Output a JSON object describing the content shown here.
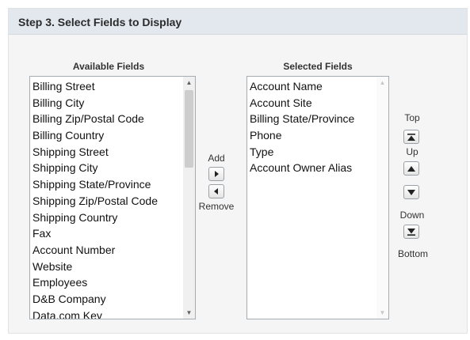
{
  "step_title": "Step 3. Select Fields to Display",
  "available": {
    "label": "Available Fields",
    "items": [
      "Billing Street",
      "Billing City",
      "Billing Zip/Postal Code",
      "Billing Country",
      "Shipping Street",
      "Shipping City",
      "Shipping State/Province",
      "Shipping Zip/Postal Code",
      "Shipping Country",
      "Fax",
      "Account Number",
      "Website",
      "Employees",
      "D&B Company",
      "Data.com Key"
    ]
  },
  "selected": {
    "label": "Selected Fields",
    "items": [
      "Account Name",
      "Account Site",
      "Billing State/Province",
      "Phone",
      "Type",
      "Account Owner Alias"
    ]
  },
  "move_controls": {
    "add_label": "Add",
    "remove_label": "Remove"
  },
  "order_controls": {
    "top_label": "Top",
    "up_label": "Up",
    "down_label": "Down",
    "bottom_label": "Bottom"
  },
  "icons": {
    "add": "arrow-right-icon",
    "remove": "arrow-left-icon",
    "top": "arrow-top-icon",
    "up": "arrow-up-icon",
    "down": "arrow-down-icon",
    "bottom": "arrow-bottom-icon"
  },
  "colors": {
    "header_bg": "#e3e8ee",
    "panel_bg": "#f5f5f5",
    "list_border": "#a5acb2"
  }
}
